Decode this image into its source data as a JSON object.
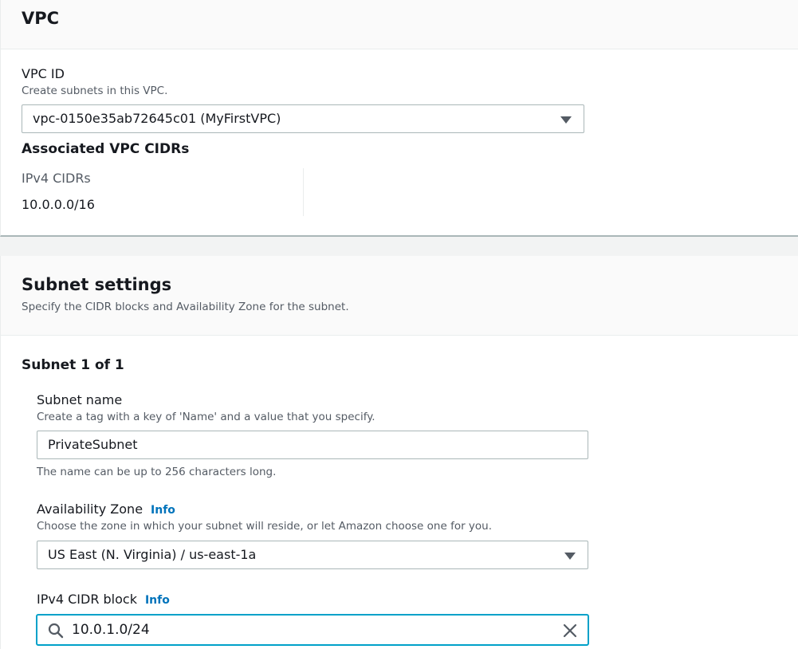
{
  "vpc_section": {
    "title": "VPC",
    "vpc_id": {
      "label": "VPC ID",
      "description": "Create subnets in this VPC.",
      "selected": "vpc-0150e35ab72645c01 (MyFirstVPC)"
    },
    "associated_cidrs": {
      "heading": "Associated VPC CIDRs",
      "ipv4_label": "IPv4 CIDRs",
      "ipv4_value": "10.0.0.0/16"
    }
  },
  "subnet_section": {
    "title": "Subnet settings",
    "subtitle": "Specify the CIDR blocks and Availability Zone for the subnet.",
    "subnet_counter": "Subnet 1 of 1",
    "subnet_name": {
      "label": "Subnet name",
      "description": "Create a tag with a key of 'Name' and a value that you specify.",
      "value": "PrivateSubnet",
      "constraint": "The name can be up to 256 characters long."
    },
    "availability_zone": {
      "label": "Availability Zone",
      "info": "Info",
      "description": "Choose the zone in which your subnet will reside, or let Amazon choose one for you.",
      "selected": "US East (N. Virginia) / us-east-1a"
    },
    "ipv4_cidr_block": {
      "label": "IPv4 CIDR block",
      "info": "Info",
      "value": "10.0.1.0/24"
    }
  },
  "icons": {
    "dropdown": "caret-down-icon",
    "search": "search-icon",
    "clear": "close-icon"
  },
  "colors": {
    "link": "#0073bb",
    "focus_border": "#00a1c9",
    "border": "#aab7b8",
    "secondary_text": "#545b64"
  }
}
